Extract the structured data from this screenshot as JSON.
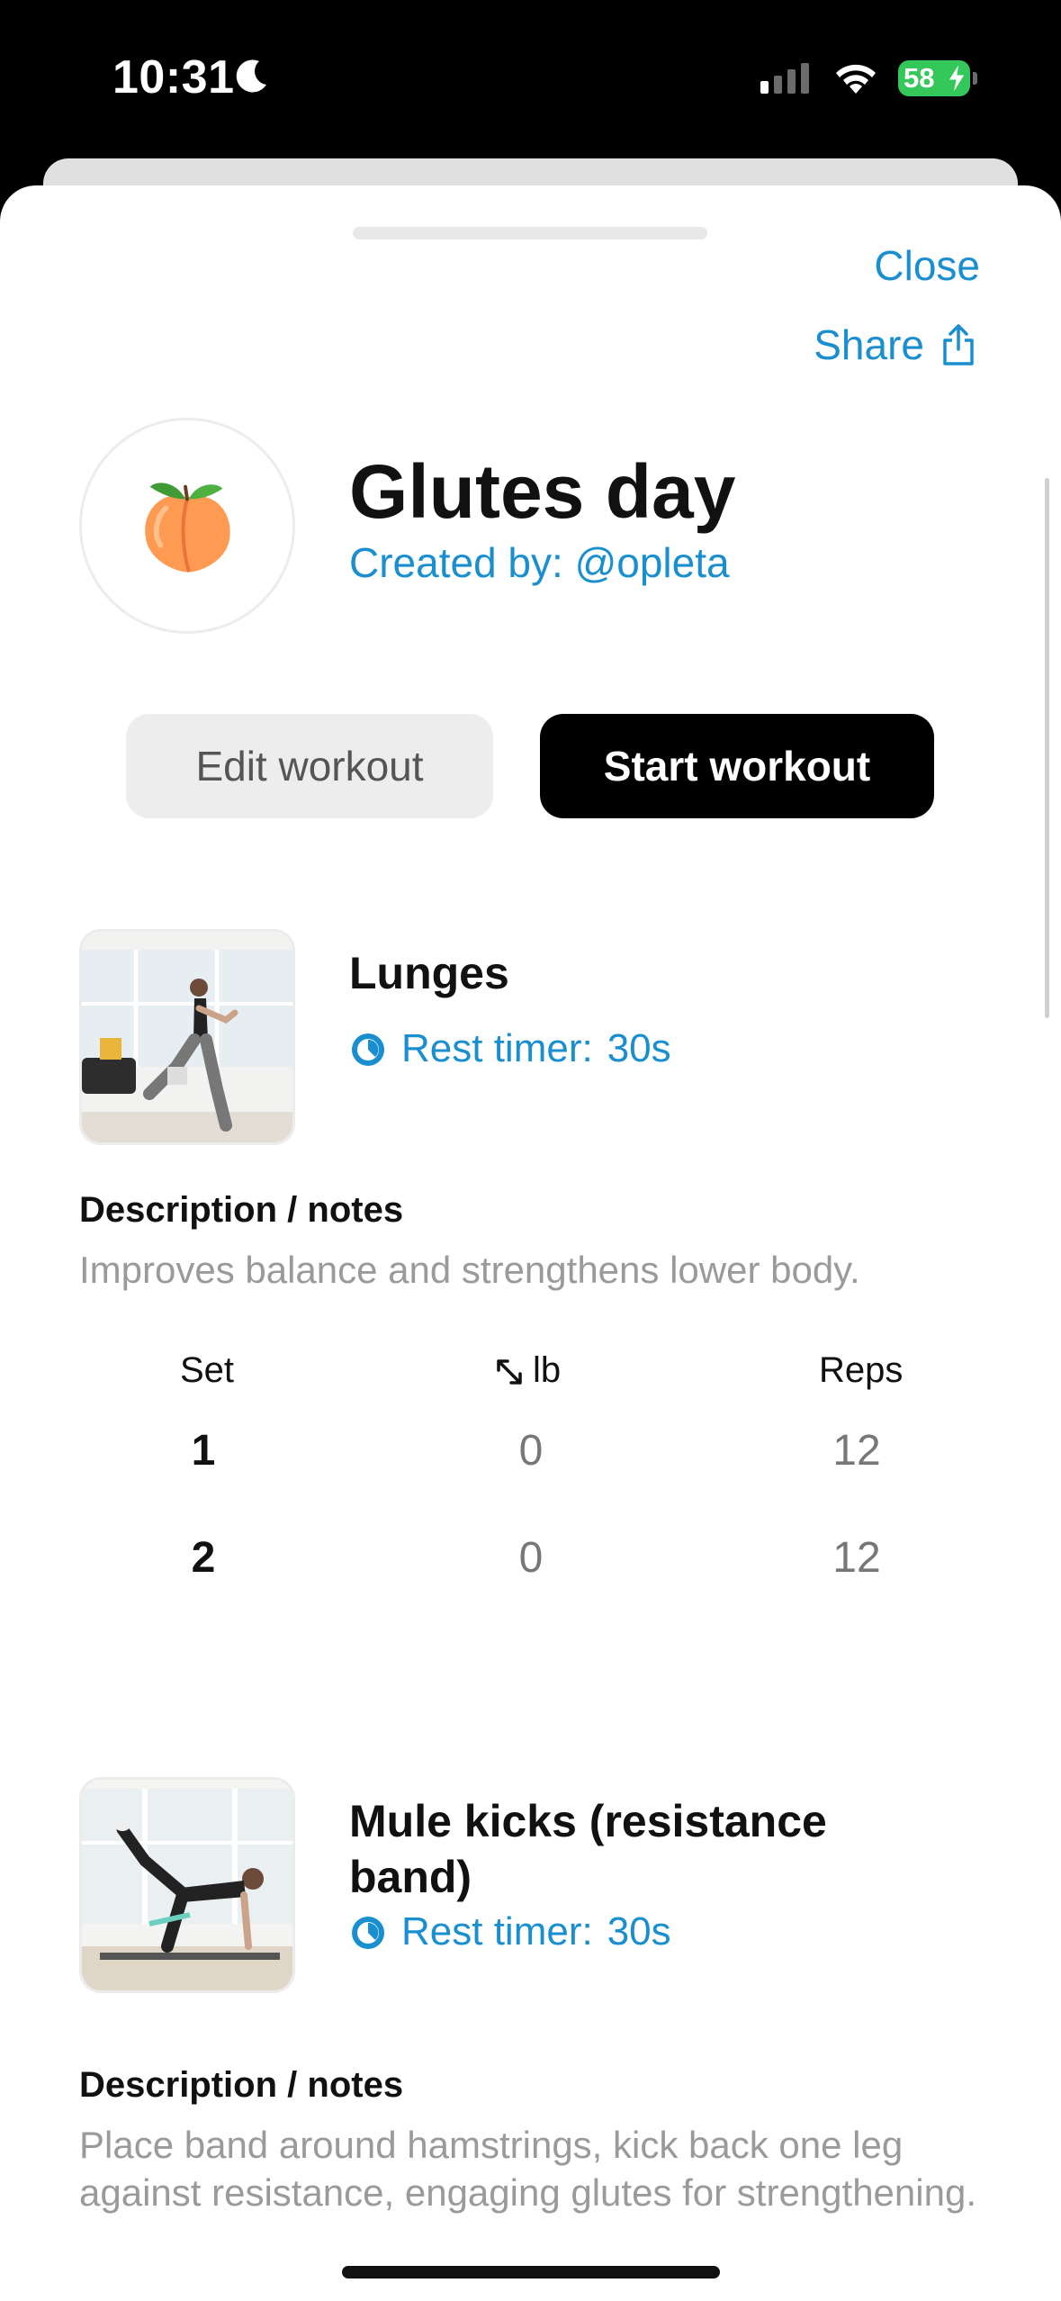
{
  "status_bar": {
    "time": "10:31",
    "battery": "58",
    "icons": [
      "moon-icon",
      "cellular-signal-icon",
      "wifi-icon",
      "battery-charging-icon"
    ]
  },
  "header": {
    "close_label": "Close",
    "share_label": "Share",
    "emoji": "🍑",
    "title": "Glutes day",
    "creator": "Created by: @opleta"
  },
  "actions": {
    "edit_label": "Edit workout",
    "start_label": "Start workout"
  },
  "exercises": [
    {
      "name": "Lunges",
      "rest_label": "Rest timer:",
      "rest_value": "30s",
      "desc_label": "Description / notes",
      "desc_text": "Improves balance and strengthens lower body.",
      "columns": {
        "set": "Set",
        "weight": "lb",
        "reps": "Reps"
      },
      "sets": [
        {
          "set": "1",
          "weight": "0",
          "reps": "12"
        },
        {
          "set": "2",
          "weight": "0",
          "reps": "12"
        }
      ]
    },
    {
      "name": "Mule kicks (resistance band)",
      "rest_label": "Rest timer:",
      "rest_value": "30s",
      "desc_label": "Description / notes",
      "desc_text": "Place band around hamstrings, kick back one leg against resistance, engaging glutes for strengthening."
    }
  ],
  "colors": {
    "accent": "#1a8fcf",
    "primary_button": "#000000",
    "secondary_button": "#ededed",
    "muted_text": "#9a9a9a"
  }
}
